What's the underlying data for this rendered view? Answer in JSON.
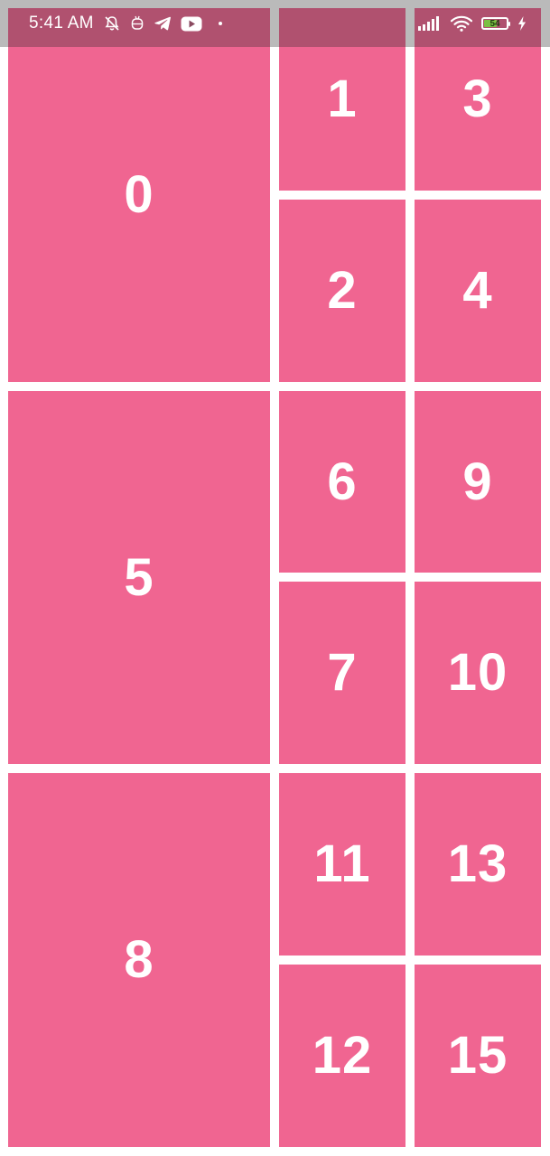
{
  "status_bar": {
    "time": "5:41 AM",
    "icons_left": [
      "muted-bell-icon",
      "bot-icon",
      "telegram-icon",
      "youtube-icon",
      "dot-icon"
    ],
    "icons_right": [
      "signal-icon",
      "wifi-icon",
      "battery-icon",
      "charging-icon"
    ],
    "battery_level": "54",
    "battery_color": "#7bc043"
  },
  "grid": {
    "tile_color": "#f06591",
    "tiles": [
      {
        "label": "0"
      },
      {
        "label": "1"
      },
      {
        "label": "2"
      },
      {
        "label": "3"
      },
      {
        "label": "4"
      },
      {
        "label": "5"
      },
      {
        "label": "6"
      },
      {
        "label": "7"
      },
      {
        "label": "8"
      },
      {
        "label": "9"
      },
      {
        "label": "10"
      },
      {
        "label": "11"
      },
      {
        "label": "12"
      },
      {
        "label": "13"
      },
      {
        "label": "15"
      }
    ]
  }
}
